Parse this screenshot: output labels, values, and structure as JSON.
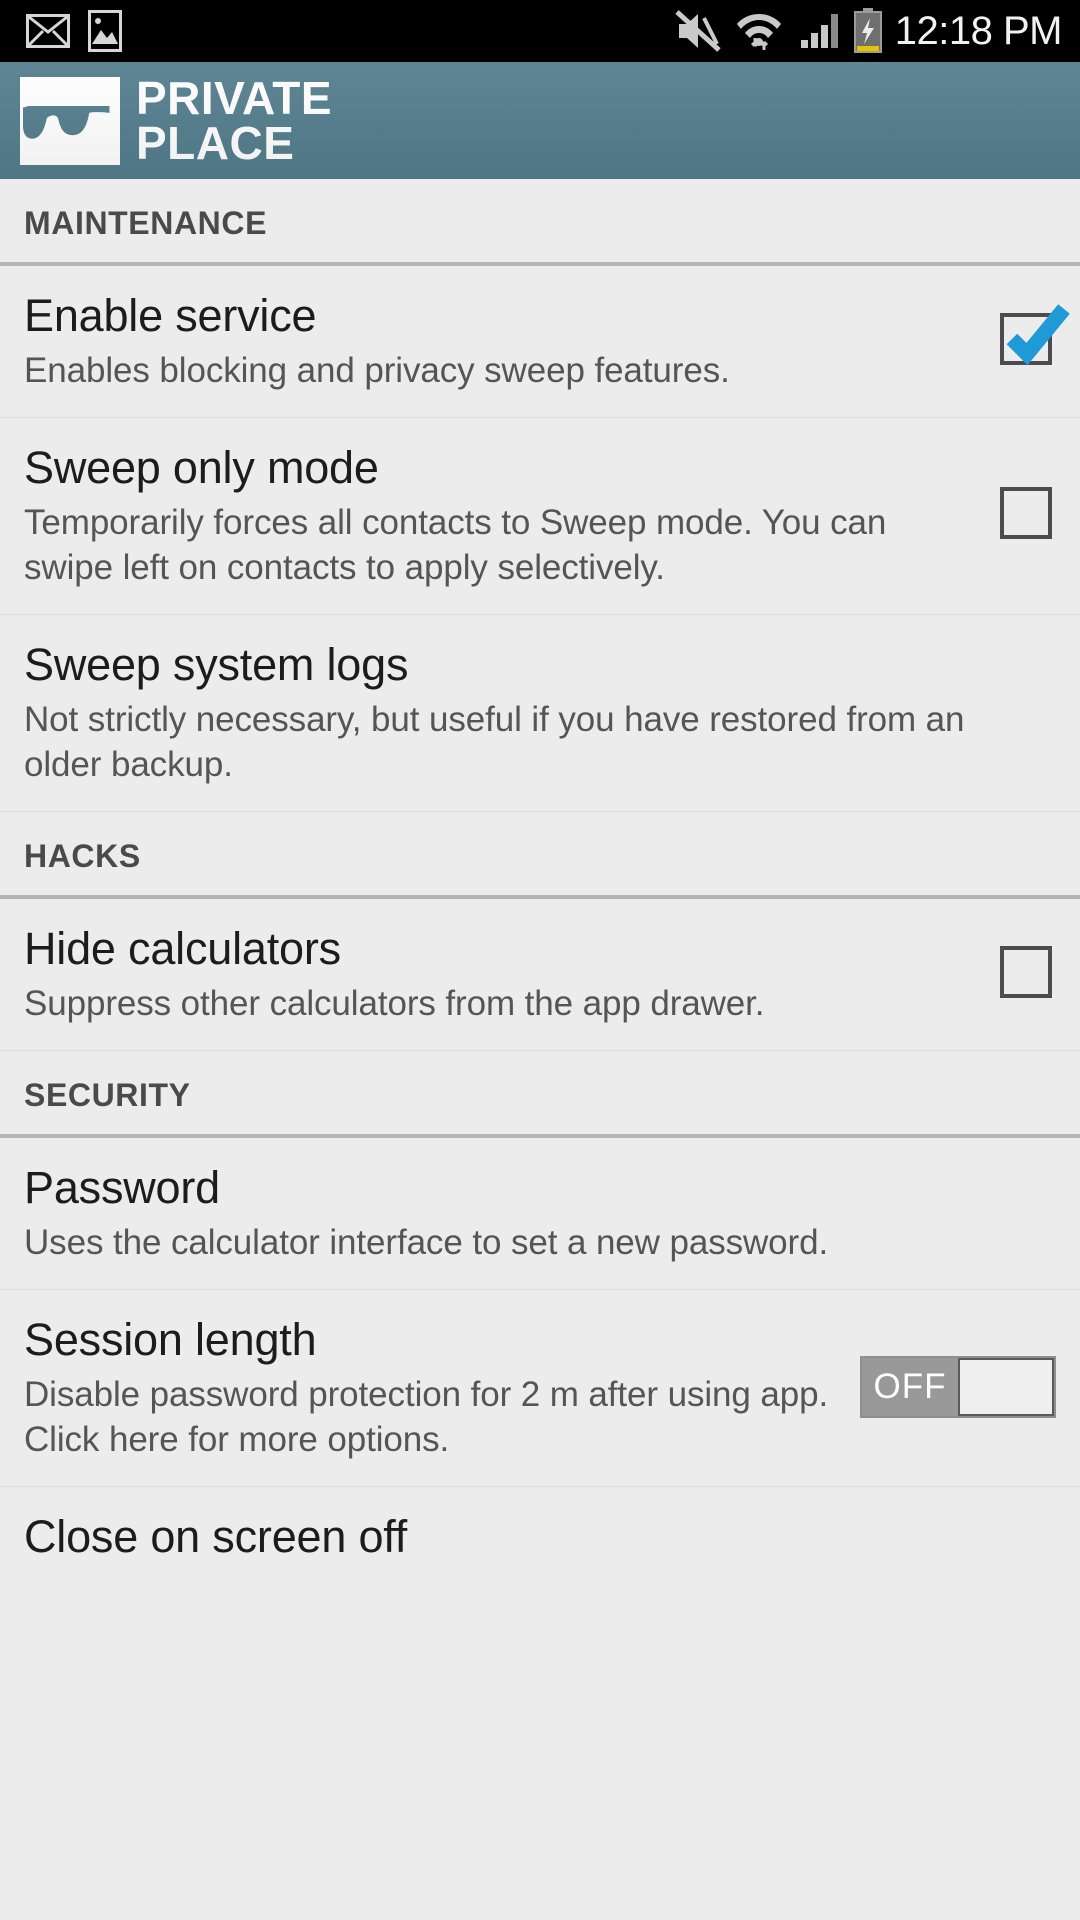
{
  "statusbar": {
    "time": "12:18 PM",
    "icons": [
      {
        "name": "email-icon"
      },
      {
        "name": "image-icon"
      },
      {
        "name": "mute-icon"
      },
      {
        "name": "wifi-icon"
      },
      {
        "name": "cellular-signal-icon"
      },
      {
        "name": "battery-charging-icon"
      }
    ]
  },
  "appbar": {
    "logo_icon": "private-place-logo-icon",
    "title_line1": "PRIVATE",
    "title_line2": "PLACE",
    "background_color": "#537d8c"
  },
  "colors": {
    "accent_checkbox": "#1e9ad6",
    "page_background": "#ececec",
    "title_text": "#1c1c1c",
    "summary_text": "#555555",
    "section_header_text": "#4a4a4a"
  },
  "sections": [
    {
      "header": "MAINTENANCE",
      "items": [
        {
          "title": "Enable service",
          "summary": "Enables blocking and privacy sweep features.",
          "widget": "checkbox",
          "checked": true
        },
        {
          "title": "Sweep only mode",
          "summary": "Temporarily forces all contacts to Sweep mode. You can swipe left on contacts to apply selectively.",
          "widget": "checkbox",
          "checked": false
        },
        {
          "title": "Sweep system logs",
          "summary": "Not strictly necessary, but useful if you have restored from an older backup.",
          "widget": "none",
          "checked": false
        }
      ]
    },
    {
      "header": "HACKS",
      "items": [
        {
          "title": "Hide calculators",
          "summary": "Suppress other calculators from the app drawer.",
          "widget": "checkbox",
          "checked": false
        }
      ]
    },
    {
      "header": "SECURITY",
      "items": [
        {
          "title": "Password",
          "summary": "Uses the calculator interface to set a new password.",
          "widget": "none",
          "checked": false
        },
        {
          "title": "Session length",
          "summary": "Disable password protection for 2 m after using app. Click here for more options.",
          "widget": "toggle",
          "toggle_label": "OFF",
          "toggle_on": false
        },
        {
          "title": "Close on screen off",
          "summary": "",
          "widget": "none",
          "checked": false
        }
      ]
    }
  ]
}
